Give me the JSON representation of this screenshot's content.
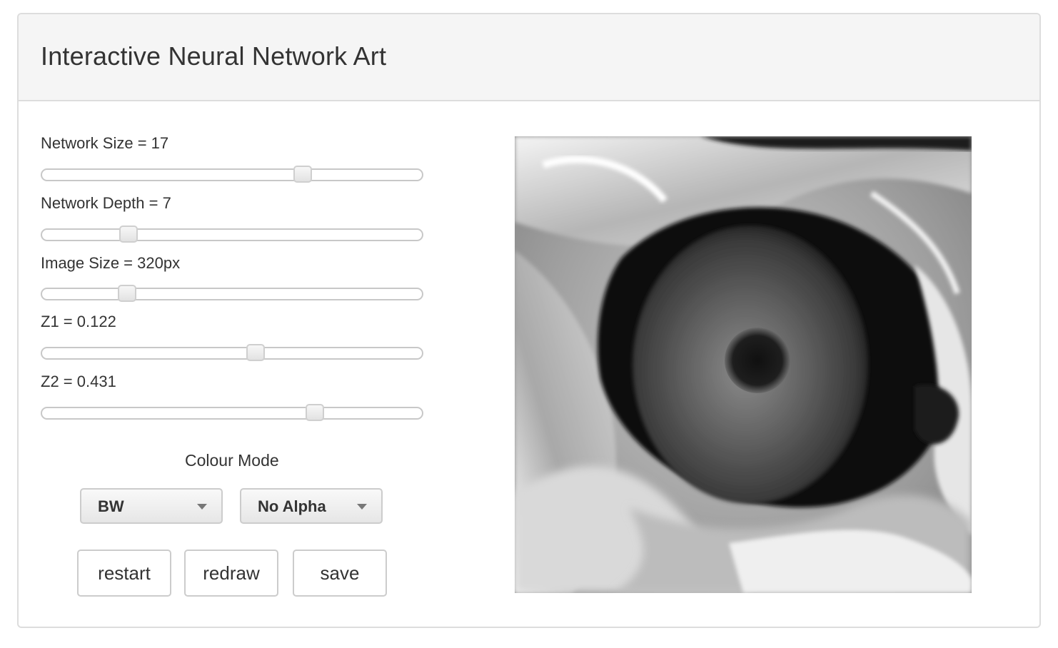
{
  "app": {
    "title": "Interactive Neural Network Art"
  },
  "controls": {
    "network_size": {
      "label": "Network Size = 17",
      "fraction": 0.684
    },
    "network_depth": {
      "label": "Network Depth = 7",
      "fraction": 0.229
    },
    "image_size": {
      "label": "Image Size = 320px",
      "fraction": 0.225
    },
    "z1": {
      "label": "Z1 = 0.122",
      "fraction": 0.562
    },
    "z2": {
      "label": "Z2 = 0.431",
      "fraction": 0.717
    }
  },
  "colour_mode": {
    "label": "Colour Mode",
    "mode_value": "BW",
    "alpha_value": "No Alpha"
  },
  "buttons": {
    "restart": "restart",
    "redraw": "redraw",
    "save": "save"
  },
  "artwork": {
    "description_icon": "generated-art-image"
  }
}
